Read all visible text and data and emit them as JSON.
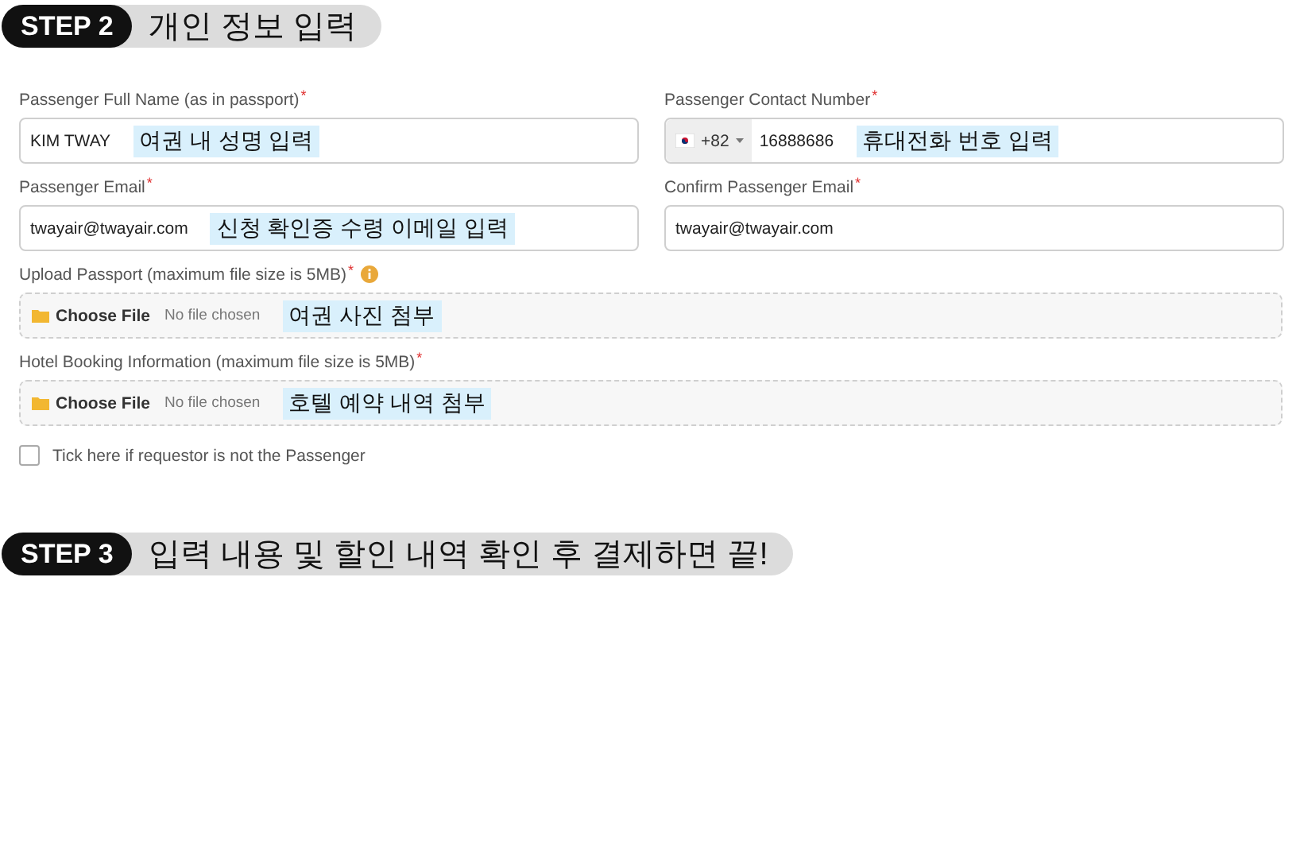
{
  "step_2": {
    "badge": "STEP 2",
    "title": "개인 정보 입력"
  },
  "fields": [
    {
      "kind": "text",
      "label": "Passenger Full Name (as in passport)",
      "required_mark": "*",
      "value": "KIM TWAY",
      "note": "여권 내 성명 입력"
    },
    {
      "kind": "phone",
      "label": "Passenger Contact Number",
      "required_mark": "*",
      "country_code": "+82",
      "value": "16888686",
      "note": "휴대전화 번호 입력"
    },
    {
      "kind": "text",
      "label": "Passenger Email",
      "required_mark": "*",
      "value": "twayair@twayair.com",
      "note": "신청 확인증 수령 이메일 입력"
    },
    {
      "kind": "text",
      "label": "Confirm Passenger Email",
      "required_mark": "*",
      "value": "twayair@twayair.com"
    }
  ],
  "uploads": [
    {
      "label": "Upload Passport (maximum file size is 5MB)",
      "required_mark": "*",
      "info": true,
      "button": "Choose File",
      "status": "No file chosen",
      "note": "여권 사진 첨부"
    },
    {
      "label": "Hotel Booking Information (maximum file size is 5MB)",
      "required_mark": "*",
      "info": false,
      "button": "Choose File",
      "status": "No file chosen",
      "note": "호텔 예약 내역 첨부"
    }
  ],
  "checkbox": {
    "label": "Tick here if requestor is not the Passenger",
    "checked": false
  },
  "step_3": {
    "badge": "STEP 3",
    "title": "입력 내용 및 할인 내역 확인 후 결제하면 끝!"
  }
}
